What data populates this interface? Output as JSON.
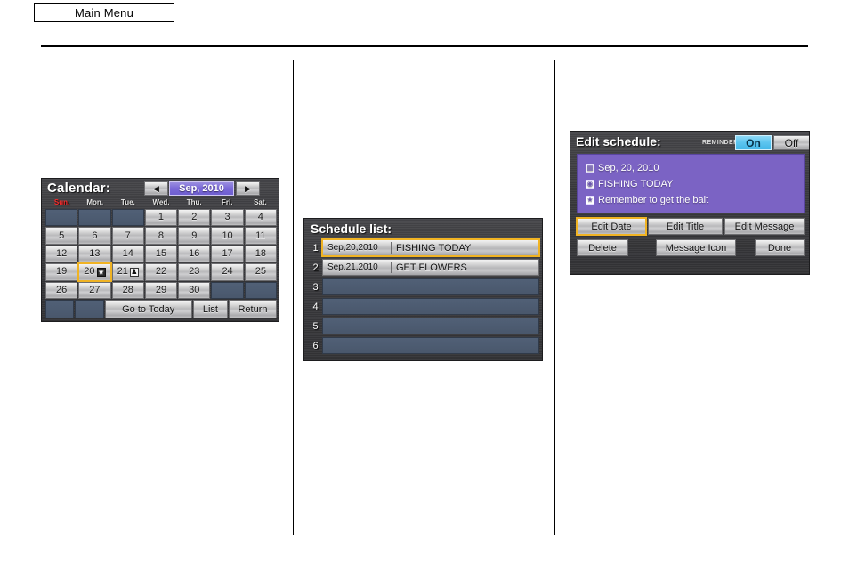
{
  "page": {
    "main_menu_label": "Main Menu"
  },
  "calendar": {
    "title": "Calendar:",
    "month_display": "Sep, 2010",
    "prev_icon": "left-triangle",
    "next_icon": "right-triangle",
    "weekdays": [
      "Sun.",
      "Mon.",
      "Tue.",
      "Wed.",
      "Thu.",
      "Fri.",
      "Sat."
    ],
    "cells": [
      {
        "day": "",
        "icon": ""
      },
      {
        "day": "",
        "icon": ""
      },
      {
        "day": "",
        "icon": ""
      },
      {
        "day": "1",
        "icon": ""
      },
      {
        "day": "2",
        "icon": ""
      },
      {
        "day": "3",
        "icon": ""
      },
      {
        "day": "4",
        "icon": ""
      },
      {
        "day": "5",
        "icon": ""
      },
      {
        "day": "6",
        "icon": ""
      },
      {
        "day": "7",
        "icon": ""
      },
      {
        "day": "8",
        "icon": ""
      },
      {
        "day": "9",
        "icon": ""
      },
      {
        "day": "10",
        "icon": ""
      },
      {
        "day": "11",
        "icon": ""
      },
      {
        "day": "12",
        "icon": ""
      },
      {
        "day": "13",
        "icon": ""
      },
      {
        "day": "14",
        "icon": ""
      },
      {
        "day": "15",
        "icon": ""
      },
      {
        "day": "16",
        "icon": ""
      },
      {
        "day": "17",
        "icon": ""
      },
      {
        "day": "18",
        "icon": ""
      },
      {
        "day": "19",
        "icon": ""
      },
      {
        "day": "20",
        "icon": "star-icon"
      },
      {
        "day": "21",
        "icon": "person-icon"
      },
      {
        "day": "22",
        "icon": ""
      },
      {
        "day": "23",
        "icon": ""
      },
      {
        "day": "24",
        "icon": ""
      },
      {
        "day": "25",
        "icon": ""
      },
      {
        "day": "26",
        "icon": ""
      },
      {
        "day": "27",
        "icon": ""
      },
      {
        "day": "28",
        "icon": ""
      },
      {
        "day": "29",
        "icon": ""
      },
      {
        "day": "30",
        "icon": ""
      },
      {
        "day": "",
        "icon": ""
      },
      {
        "day": "",
        "icon": ""
      }
    ],
    "selected_day": "20",
    "buttons": {
      "go_to_today": "Go to Today",
      "list": "List",
      "return": "Return"
    },
    "colors": {
      "selection_outline": "#f0b323",
      "month_badge": "#7a68d8",
      "sunday_text": "#ff2a2a",
      "screen_background": "#3b3b3e",
      "empty_cell": "#4e5d73"
    }
  },
  "schedule_list": {
    "title": "Schedule list:",
    "rows": [
      {
        "index": "1",
        "date": "Sep,20,2010",
        "text": "FISHING TODAY",
        "filled": true,
        "selected": true
      },
      {
        "index": "2",
        "date": "Sep,21,2010",
        "text": "GET FLOWERS",
        "filled": true,
        "selected": false
      },
      {
        "index": "3",
        "date": "",
        "text": "",
        "filled": false,
        "selected": false
      },
      {
        "index": "4",
        "date": "",
        "text": "",
        "filled": false,
        "selected": false
      },
      {
        "index": "5",
        "date": "",
        "text": "",
        "filled": false,
        "selected": false
      },
      {
        "index": "6",
        "date": "",
        "text": "",
        "filled": false,
        "selected": false
      }
    ]
  },
  "edit_schedule": {
    "title": "Edit schedule:",
    "reminder_label": "REMINDER",
    "reminder_on": "On",
    "reminder_off": "Off",
    "reminder_state": "On",
    "content": {
      "date": "Sep, 20, 2010",
      "date_icon": "calendar-icon",
      "schedule_title": "FISHING TODAY",
      "title_icon": "note-icon",
      "message": "Remember to get the bait",
      "message_icon": "star-icon",
      "background_color": "#7b63c4"
    },
    "buttons": {
      "edit_date": "Edit Date",
      "edit_title": "Edit Title",
      "edit_message": "Edit Message",
      "delete": "Delete",
      "message_icon": "Message Icon",
      "done": "Done"
    },
    "selected_button": "Edit Date"
  }
}
